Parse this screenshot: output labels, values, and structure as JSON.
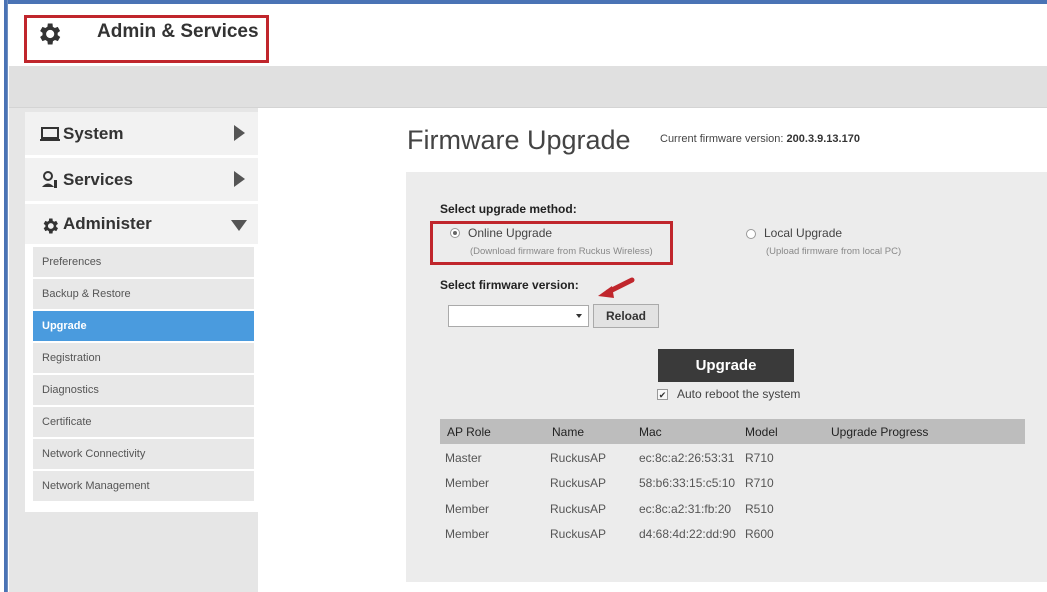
{
  "header": {
    "title": "Admin & Services",
    "icon": "gear-icon"
  },
  "sidebar": {
    "sections": [
      {
        "label": "System",
        "icon": "laptop-icon"
      },
      {
        "label": "Services",
        "icon": "services-icon"
      },
      {
        "label": "Administer",
        "icon": "gear-icon"
      }
    ],
    "items": [
      {
        "label": "Preferences"
      },
      {
        "label": "Backup & Restore"
      },
      {
        "label": "Upgrade",
        "active": true
      },
      {
        "label": "Registration"
      },
      {
        "label": "Diagnostics"
      },
      {
        "label": "Certificate"
      },
      {
        "label": "Network Connectivity"
      },
      {
        "label": "Network Management"
      }
    ]
  },
  "main": {
    "title": "Firmware Upgrade",
    "fw_prefix": "Current firmware version:",
    "fw_version": "200.3.9.13.170",
    "select_method_label": "Select upgrade method:",
    "online_label": "Online Upgrade",
    "online_sub": "(Download firmware from Ruckus Wireless)",
    "local_label": "Local Upgrade",
    "local_sub": "(Upload firmware from local PC)",
    "select_version_label": "Select firmware version:",
    "select_value": "",
    "reload_label": "Reload",
    "upgrade_label": "Upgrade",
    "auto_reboot_label": "Auto reboot the system",
    "auto_reboot_checked": true
  },
  "table": {
    "headers": [
      "AP Role",
      "Name",
      "Mac",
      "Model",
      "Upgrade Progress"
    ],
    "rows": [
      [
        "Master",
        "RuckusAP",
        "ec:8c:a2:26:53:31",
        "R710",
        ""
      ],
      [
        "Member",
        "RuckusAP",
        "58:b6:33:15:c5:10",
        "R710",
        ""
      ],
      [
        "Member",
        "RuckusAP",
        "ec:8c:a2:31:fb:20",
        "R510",
        ""
      ],
      [
        "Member",
        "RuckusAP",
        "d4:68:4d:22:dd:90",
        "R600",
        ""
      ]
    ]
  },
  "colors": {
    "highlight_red": "#c0262c",
    "active_blue": "#4a9bde",
    "button_dark": "#3a3a3a"
  }
}
